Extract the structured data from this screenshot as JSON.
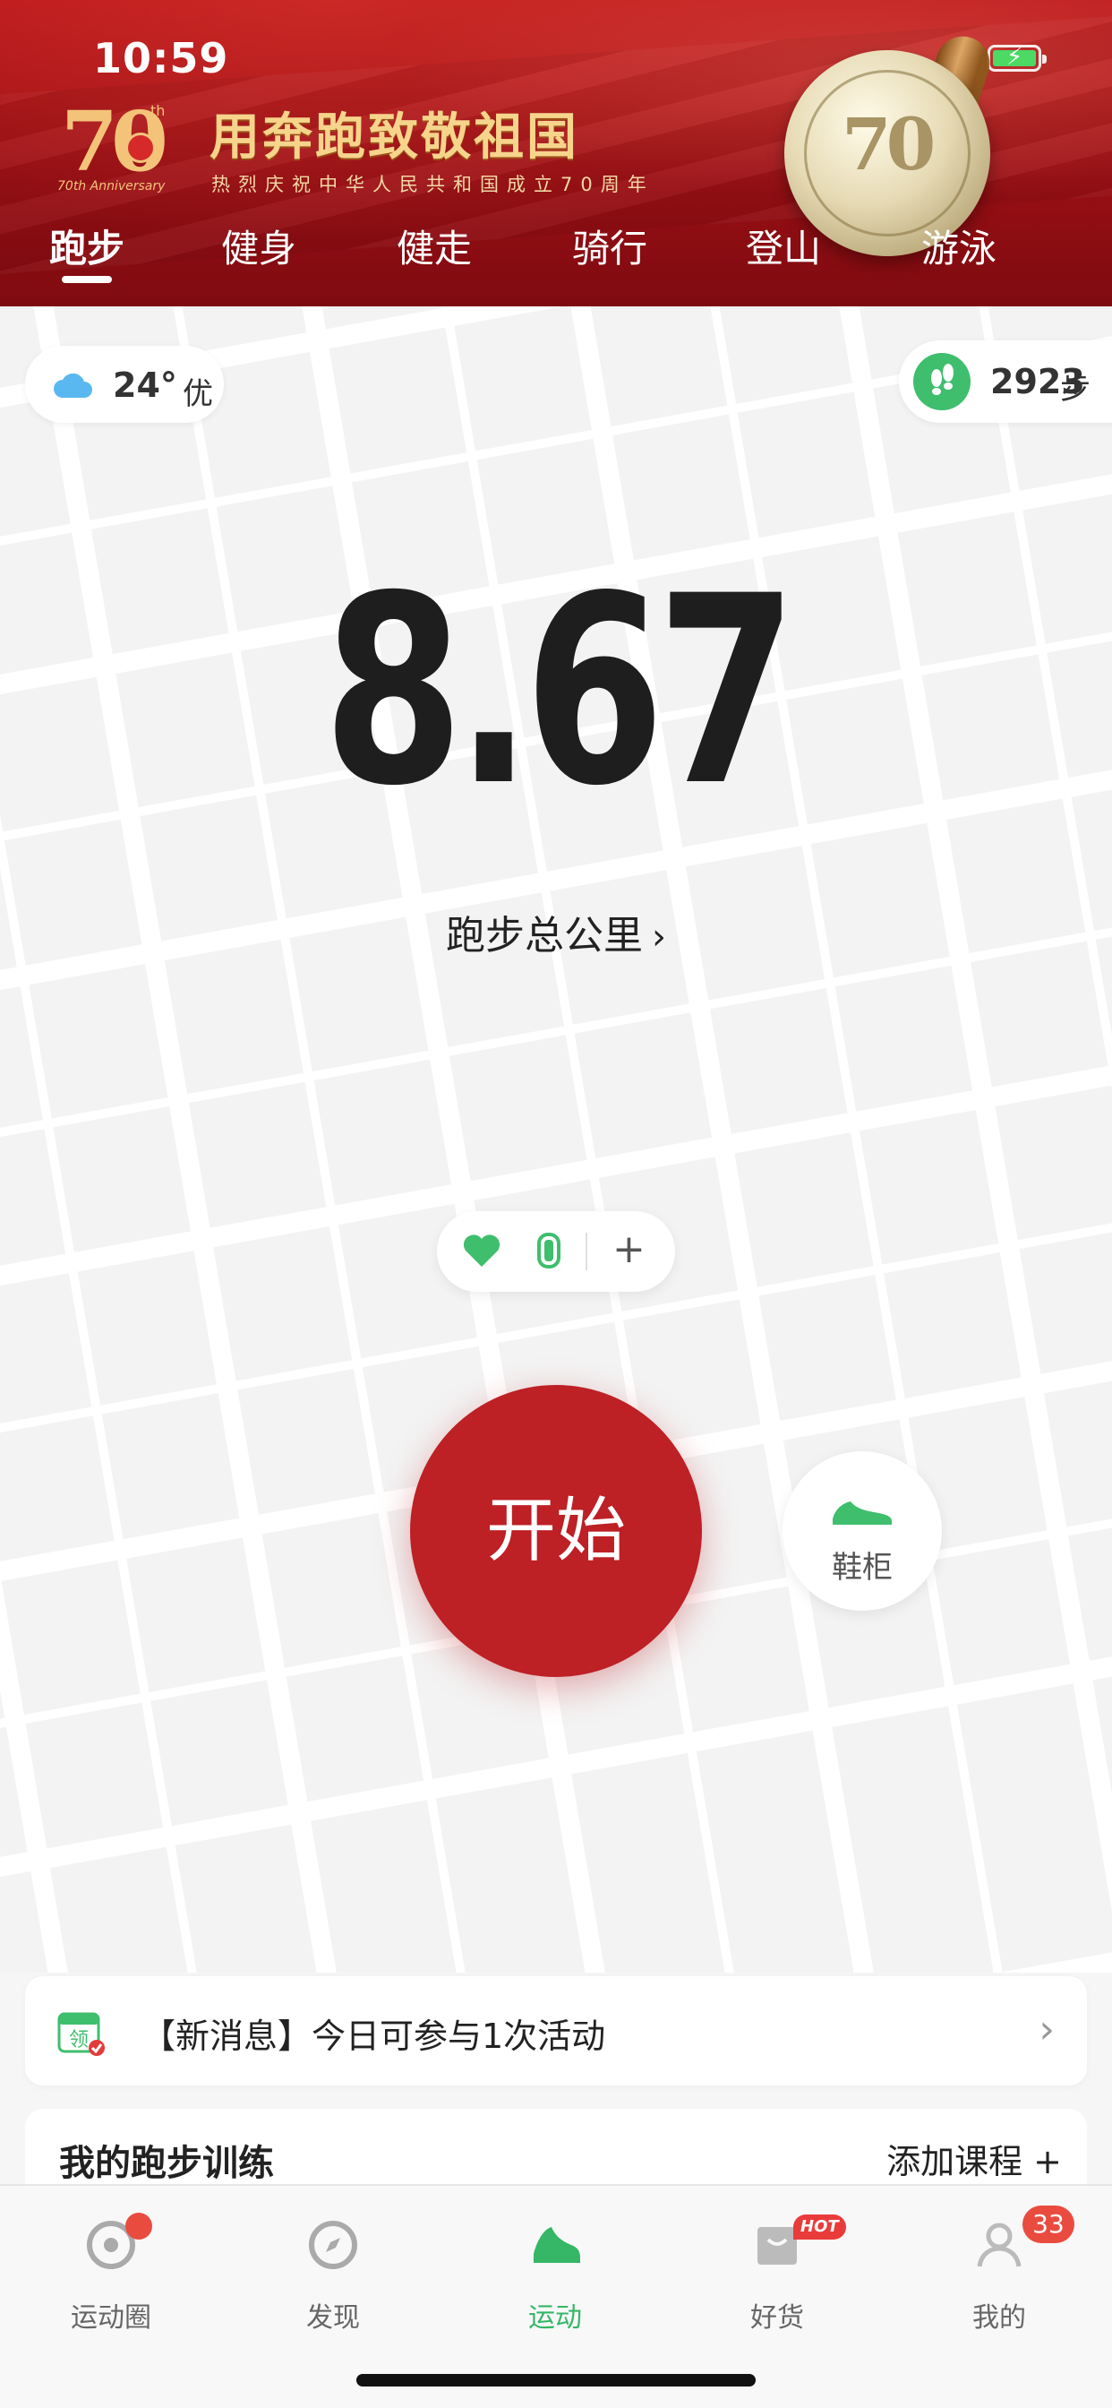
{
  "status_bar": {
    "time": "10:59"
  },
  "banner": {
    "logo_number": "70",
    "logo_superscript": "th",
    "logo_caption": "70th Anniversary",
    "title": "用奔跑致敬祖国",
    "subtitle": "热烈庆祝中华人民共和国成立70周年"
  },
  "tabs": [
    {
      "label": "跑步",
      "active": true
    },
    {
      "label": "健身"
    },
    {
      "label": "健走"
    },
    {
      "label": "骑行"
    },
    {
      "label": "登山"
    },
    {
      "label": "游泳"
    }
  ],
  "weather": {
    "icon": "cloud-icon",
    "temperature": "24°",
    "air_quality": "优"
  },
  "steps": {
    "icon": "footsteps-icon",
    "count": "2923",
    "unit": "步"
  },
  "distance": {
    "value": "8.67",
    "label": "跑步总公里",
    "chevron": "›"
  },
  "device_pill": {
    "icons": [
      "heart-icon",
      "watch-icon"
    ],
    "add_symbol": "+"
  },
  "start_button": {
    "label": "开始"
  },
  "shoe_cabinet": {
    "icon": "shoe-icon",
    "label": "鞋柜"
  },
  "notice": {
    "icon": "calendar-icon",
    "icon_text": "领",
    "text": "【新消息】今日可参与1次活动",
    "chevron": "›"
  },
  "training": {
    "title": "我的跑步训练",
    "add_label": "添加课程 +"
  },
  "bottom_nav": [
    {
      "label": "运动圈",
      "icon": "circle-icon",
      "badge": "dot"
    },
    {
      "label": "发现",
      "icon": "compass-icon"
    },
    {
      "label": "运动",
      "icon": "running-shoe-icon",
      "active": true
    },
    {
      "label": "好货",
      "icon": "shopping-bag-icon",
      "badge_text": "HOT"
    },
    {
      "label": "我的",
      "icon": "person-icon",
      "badge_count": "33"
    }
  ],
  "colors": {
    "banner_red": "#a01015",
    "start_red": "#bd2025",
    "accent_green": "#35b767",
    "gold": "#f6d48c"
  }
}
